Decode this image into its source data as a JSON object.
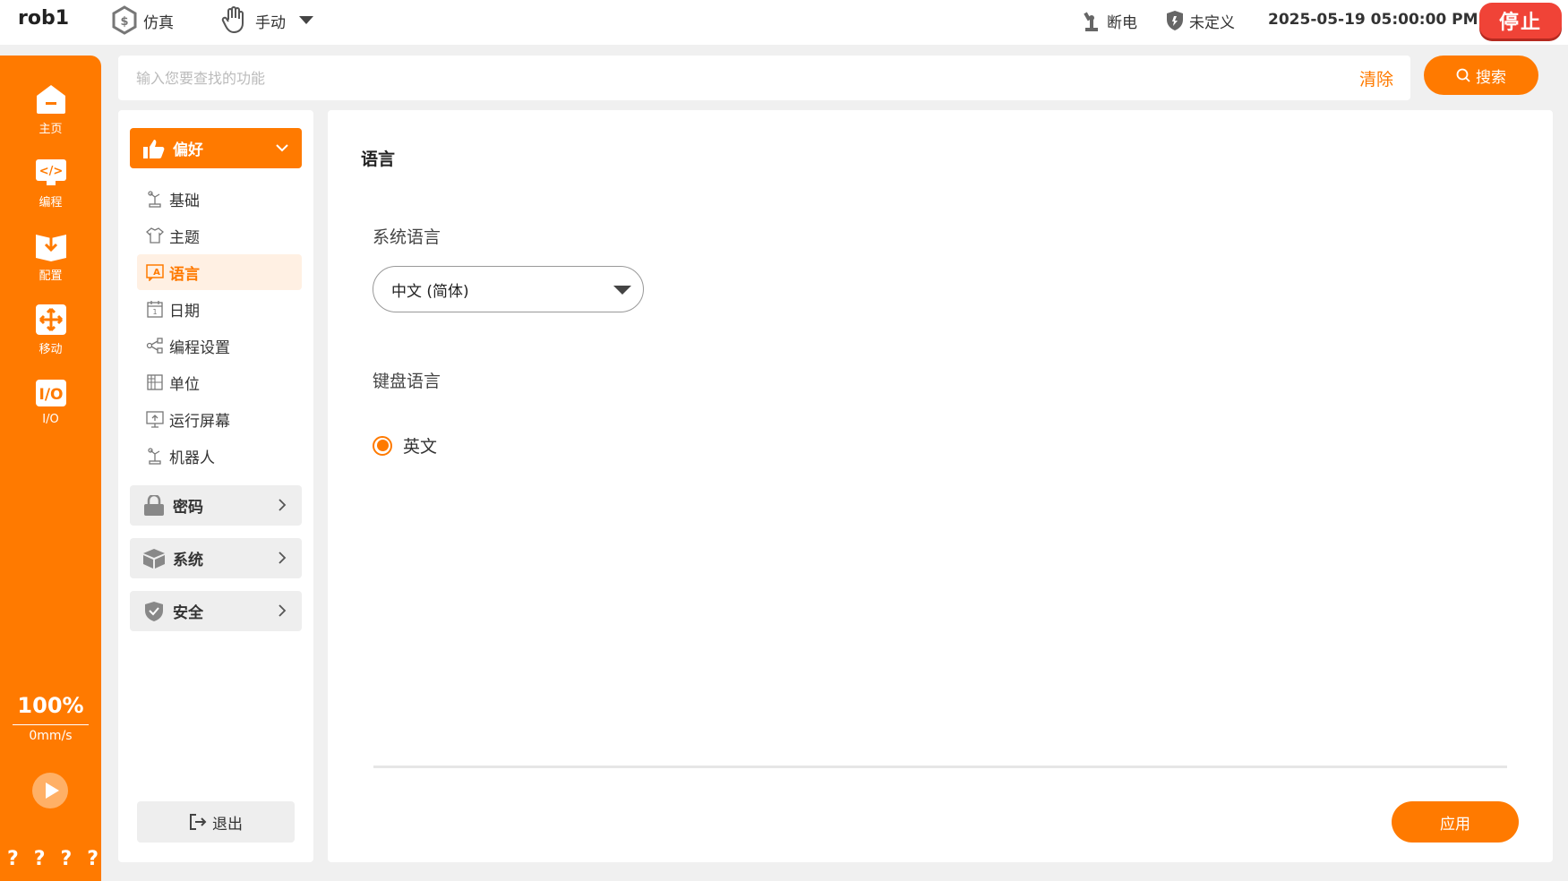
{
  "topbar": {
    "robot_name": "rob1",
    "mode": "仿真",
    "control": "手动",
    "power": "断电",
    "safety": "未定义",
    "datetime": "2025-05-19 05:00:00 PM",
    "stop_label": "停止"
  },
  "rail": {
    "items": [
      {
        "label": "主页",
        "icon": "home-icon"
      },
      {
        "label": "编程",
        "icon": "code-icon"
      },
      {
        "label": "配置",
        "icon": "config-icon"
      },
      {
        "label": "移动",
        "icon": "move-icon"
      },
      {
        "label": "I/O",
        "icon": "io-icon"
      }
    ],
    "speed_percent": "100%",
    "speed_value": "0mm/s",
    "help_marks": [
      "?",
      "?",
      "?",
      "?"
    ]
  },
  "search": {
    "placeholder": "输入您要查找的功能",
    "value": "",
    "clear_label": "清除",
    "button_label": "搜索"
  },
  "nav": {
    "active_group": {
      "label": "偏好",
      "icon": "thumbs-up-icon"
    },
    "sub_items": [
      {
        "label": "基础",
        "icon": "robot-arm-icon"
      },
      {
        "label": "主题",
        "icon": "shirt-icon"
      },
      {
        "label": "语言",
        "icon": "translate-icon",
        "selected": true
      },
      {
        "label": "日期",
        "icon": "calendar-icon"
      },
      {
        "label": "编程设置",
        "icon": "share-nodes-icon"
      },
      {
        "label": "单位",
        "icon": "grid-icon"
      },
      {
        "label": "运行屏幕",
        "icon": "monitor-icon"
      },
      {
        "label": "机器人",
        "icon": "robot-arm-icon"
      }
    ],
    "collapsed_groups": [
      {
        "label": "密码",
        "icon": "lock-icon"
      },
      {
        "label": "系统",
        "icon": "box-icon"
      },
      {
        "label": "安全",
        "icon": "shield-icon"
      }
    ],
    "logout_label": "退出"
  },
  "main": {
    "title": "语言",
    "system_language_label": "系统语言",
    "system_language_value": "中文 (简体)",
    "keyboard_language_label": "键盘语言",
    "keyboard_option": "英文",
    "apply_label": "应用"
  },
  "colors": {
    "accent": "#ff7a00",
    "stop": "#f04337",
    "selected_bg": "#fff0e3"
  }
}
